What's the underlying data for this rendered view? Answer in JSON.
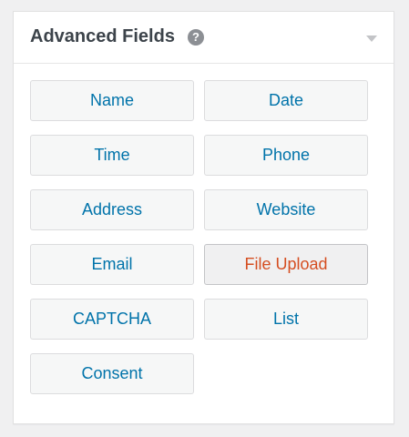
{
  "panel": {
    "title": "Advanced Fields",
    "help_icon": "help-icon",
    "toggle_icon": "chevron-down-icon"
  },
  "fields": [
    {
      "label": "Name"
    },
    {
      "label": "Date"
    },
    {
      "label": "Time"
    },
    {
      "label": "Phone"
    },
    {
      "label": "Address"
    },
    {
      "label": "Website"
    },
    {
      "label": "Email"
    },
    {
      "label": "File Upload",
      "state": "hover"
    },
    {
      "label": "CAPTCHA"
    },
    {
      "label": "List"
    },
    {
      "label": "Consent"
    }
  ],
  "colors": {
    "link": "#0073aa",
    "hover_text": "#d54e21",
    "button_bg": "#f6f7f7",
    "border": "#dcdcde"
  }
}
